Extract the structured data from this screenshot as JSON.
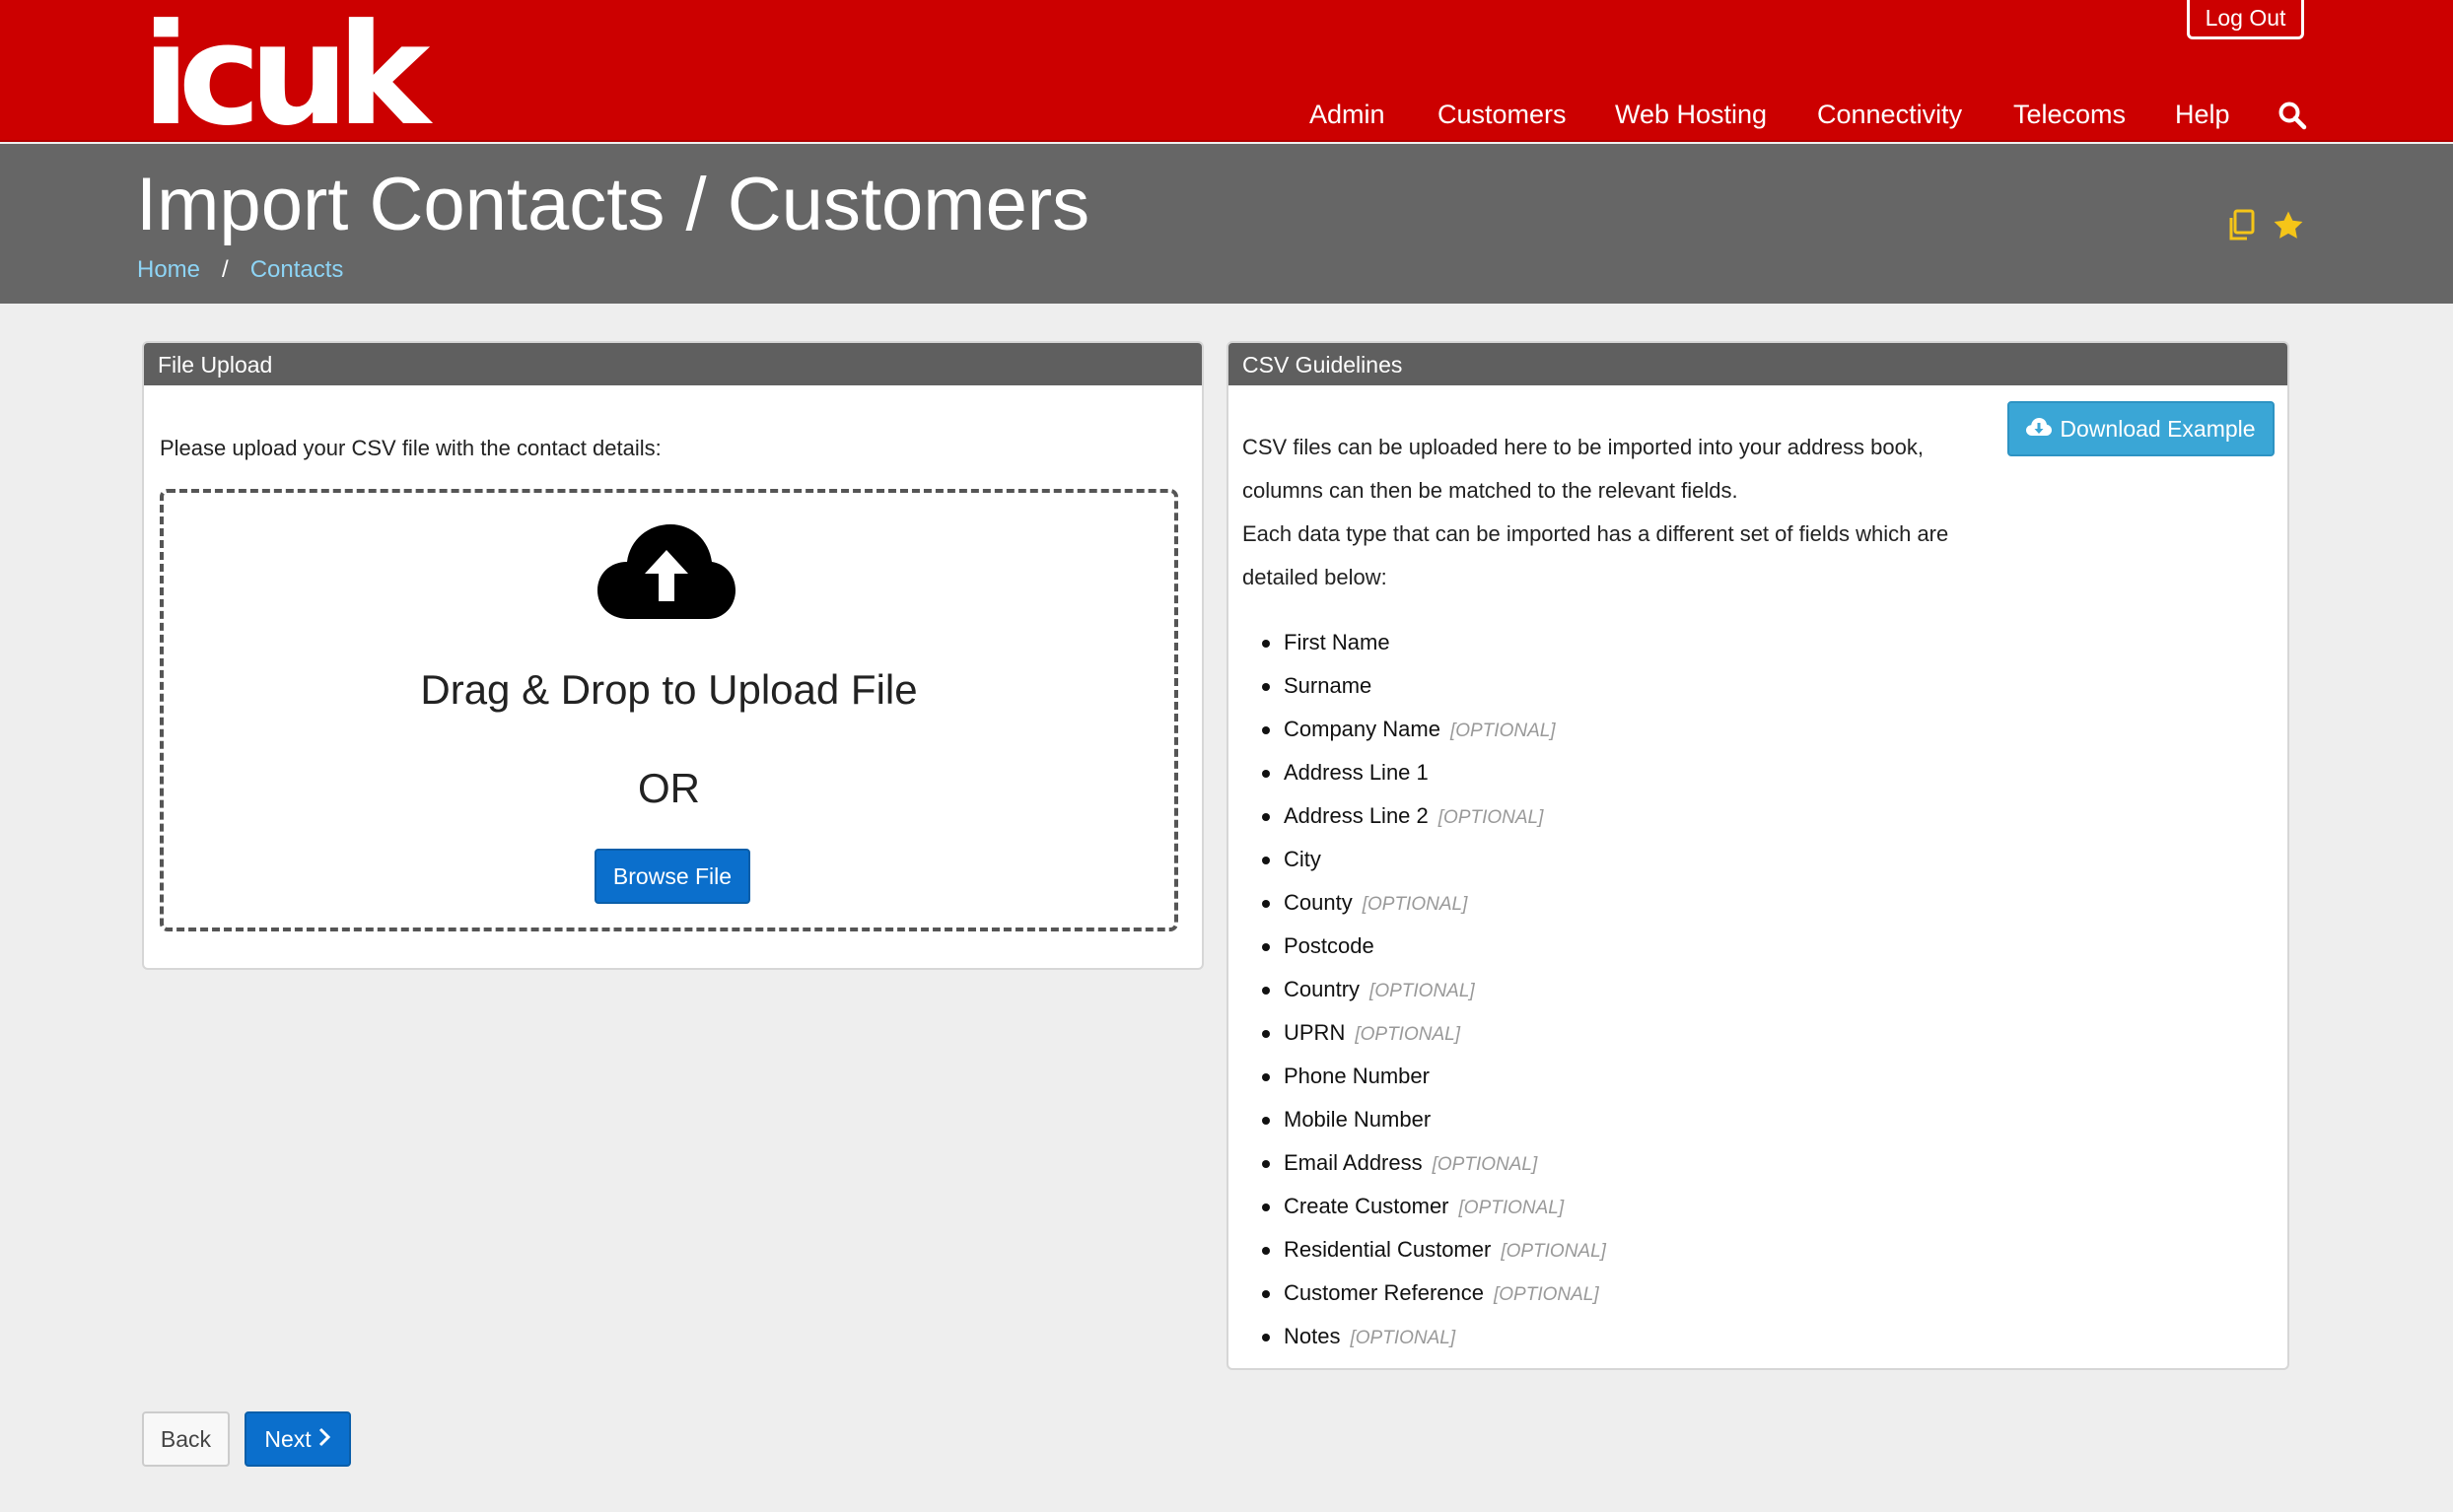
{
  "header": {
    "logo_text": "icuk",
    "logout_label": "Log Out",
    "nav": [
      "Admin",
      "Customers",
      "Web Hosting",
      "Connectivity",
      "Telecoms",
      "Help"
    ],
    "search_icon": "search-icon"
  },
  "titlebar": {
    "title": "Import Contacts / Customers",
    "breadcrumb": [
      "Home",
      "Contacts"
    ],
    "icons": [
      "copy-icon",
      "star-icon"
    ]
  },
  "upload_panel": {
    "heading": "File Upload",
    "intro": "Please upload your CSV file with the contact details:",
    "drop_text": "Drag & Drop to Upload File",
    "or_text": "OR",
    "browse_label": "Browse File",
    "icon": "cloud-upload-icon"
  },
  "csv_panel": {
    "heading": "CSV Guidelines",
    "paragraphs": [
      "CSV files can be uploaded here to be imported into your address book,",
      "columns can then be matched to the relevant fields.",
      "Each data type that can be imported has a different set of fields which are",
      "detailed below:"
    ],
    "download_label": "Download Example",
    "optional_label": "[OPTIONAL]",
    "fields": [
      {
        "name": "First Name",
        "optional": false
      },
      {
        "name": "Surname",
        "optional": false
      },
      {
        "name": "Company Name",
        "optional": true
      },
      {
        "name": "Address Line 1",
        "optional": false
      },
      {
        "name": "Address Line 2",
        "optional": true
      },
      {
        "name": "City",
        "optional": false
      },
      {
        "name": "County",
        "optional": true
      },
      {
        "name": "Postcode",
        "optional": false
      },
      {
        "name": "Country",
        "optional": true
      },
      {
        "name": "UPRN",
        "optional": true
      },
      {
        "name": "Phone Number",
        "optional": false
      },
      {
        "name": "Mobile Number",
        "optional": false
      },
      {
        "name": "Email Address",
        "optional": true
      },
      {
        "name": "Create Customer",
        "optional": true
      },
      {
        "name": "Residential Customer",
        "optional": true
      },
      {
        "name": "Customer Reference",
        "optional": true
      },
      {
        "name": "Notes",
        "optional": true
      }
    ]
  },
  "footer": {
    "back_label": "Back",
    "next_label": "Next"
  },
  "colors": {
    "brand_red": "#cc0000",
    "title_bar": "#666666",
    "primary_blue": "#0b6fcc",
    "info_blue": "#3aa6d6",
    "star_yellow": "#f5c518"
  }
}
